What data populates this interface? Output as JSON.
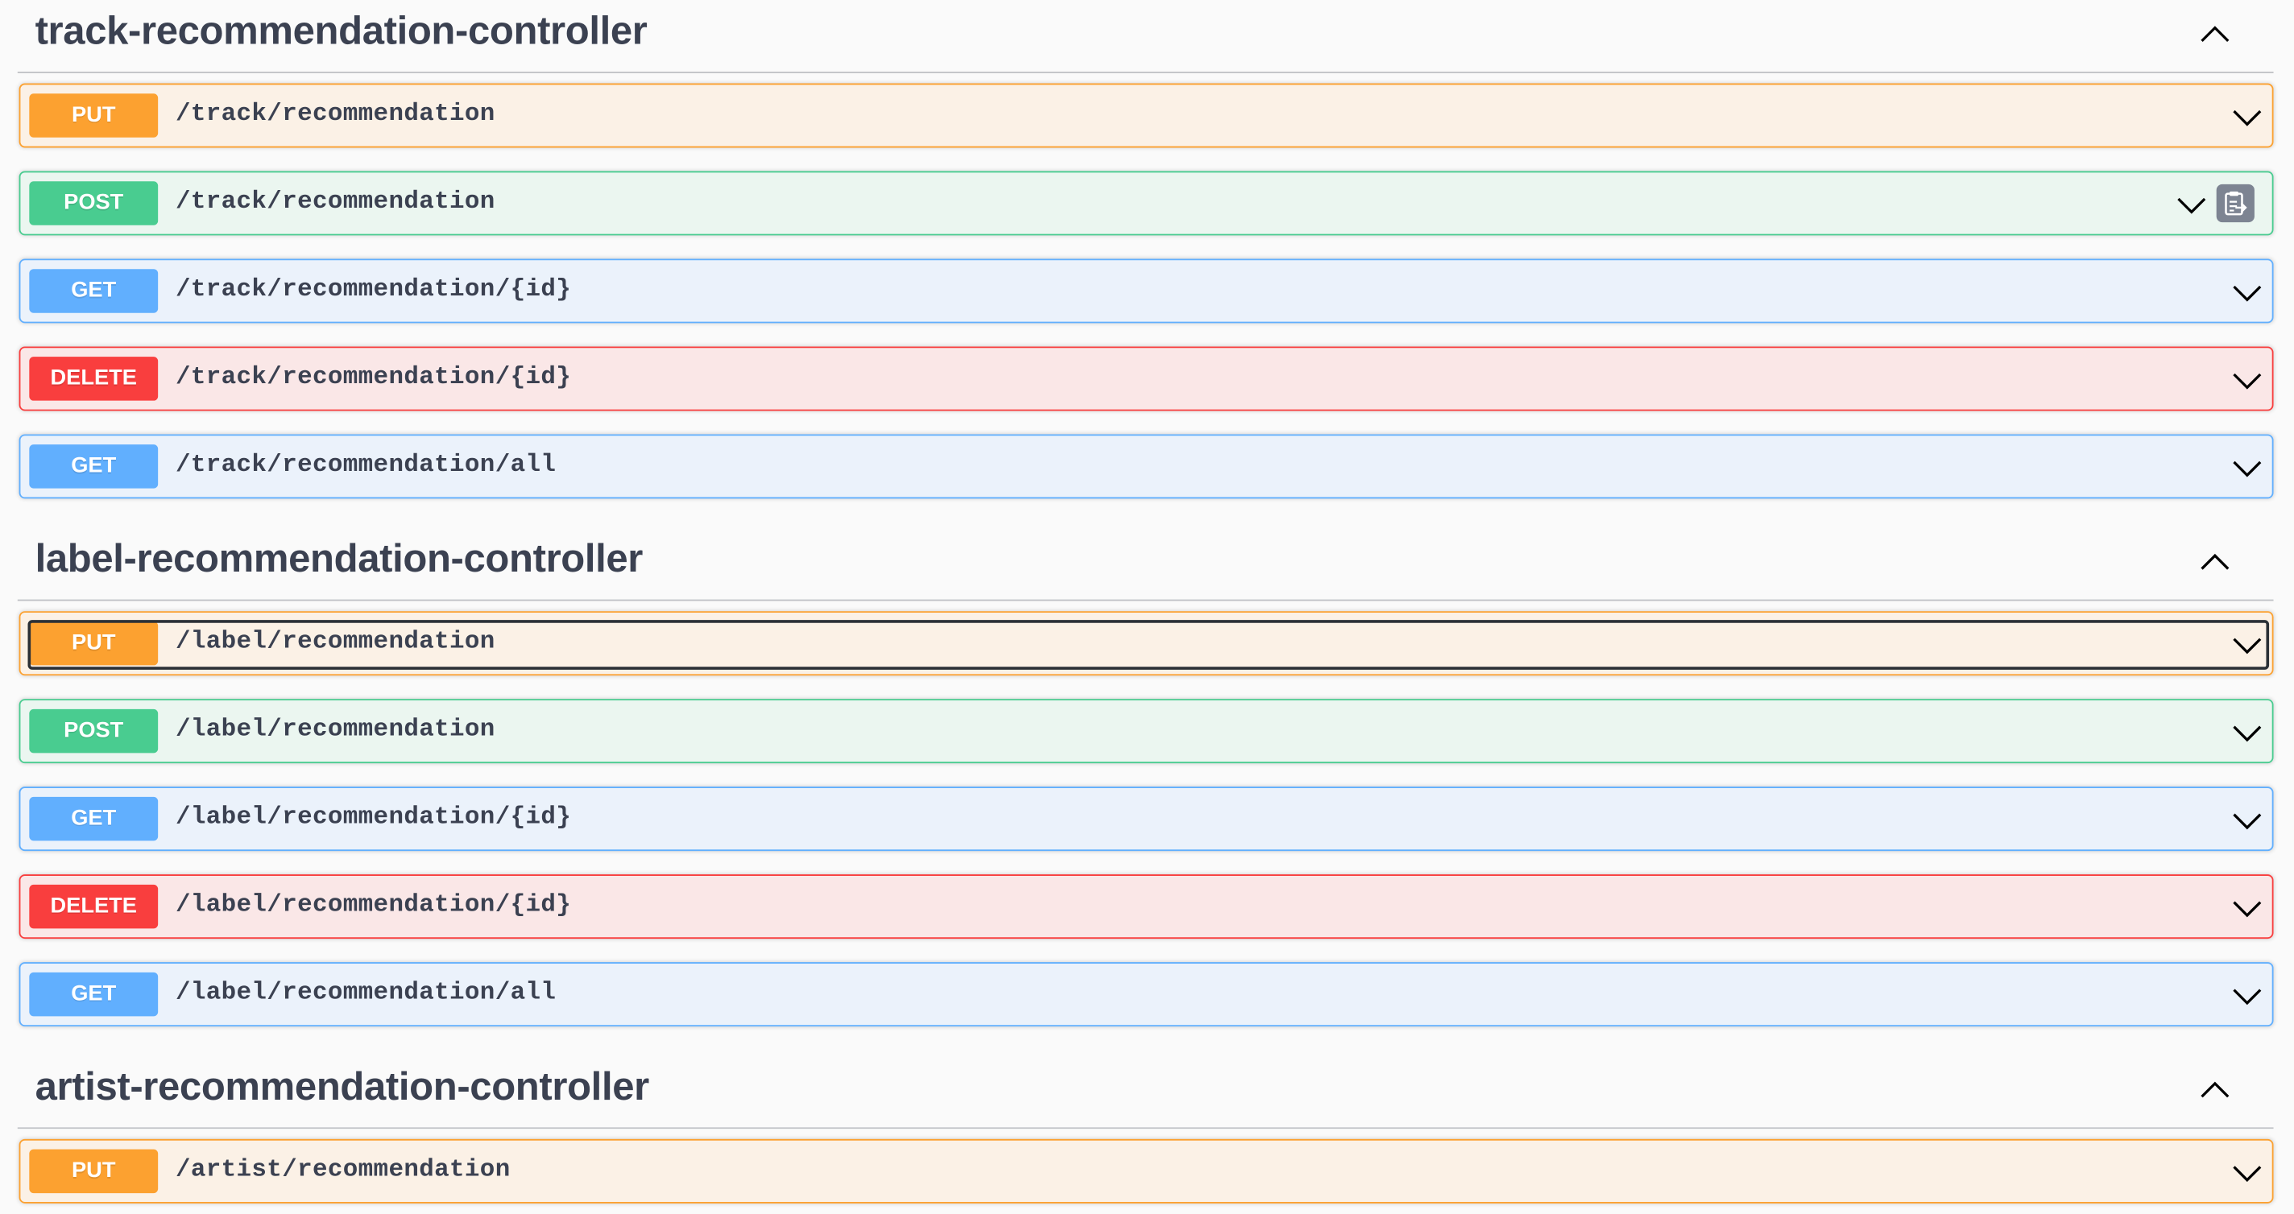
{
  "sections": [
    {
      "title": "track-recommendation-controller",
      "ops": [
        {
          "method": "PUT",
          "path": "/track/recommendation"
        },
        {
          "method": "POST",
          "path": "/track/recommendation"
        },
        {
          "method": "GET",
          "path": "/track/recommendation/{id}"
        },
        {
          "method": "DELETE",
          "path": "/track/recommendation/{id}"
        },
        {
          "method": "GET",
          "path": "/track/recommendation/all"
        }
      ]
    },
    {
      "title": "label-recommendation-controller",
      "ops": [
        {
          "method": "PUT",
          "path": "/label/recommendation"
        },
        {
          "method": "POST",
          "path": "/label/recommendation"
        },
        {
          "method": "GET",
          "path": "/label/recommendation/{id}"
        },
        {
          "method": "DELETE",
          "path": "/label/recommendation/{id}"
        },
        {
          "method": "GET",
          "path": "/label/recommendation/all"
        }
      ]
    },
    {
      "title": "artist-recommendation-controller",
      "ops": [
        {
          "method": "PUT",
          "path": "/artist/recommendation"
        }
      ]
    }
  ],
  "colors": {
    "put": "#fca130",
    "post": "#49cc90",
    "get": "#61affe",
    "delete": "#f93e3e",
    "text": "#3b4151"
  },
  "icons": {
    "expand": "chevron-down-icon",
    "collapse": "chevron-up-icon",
    "copy": "clipboard-copy-icon"
  }
}
